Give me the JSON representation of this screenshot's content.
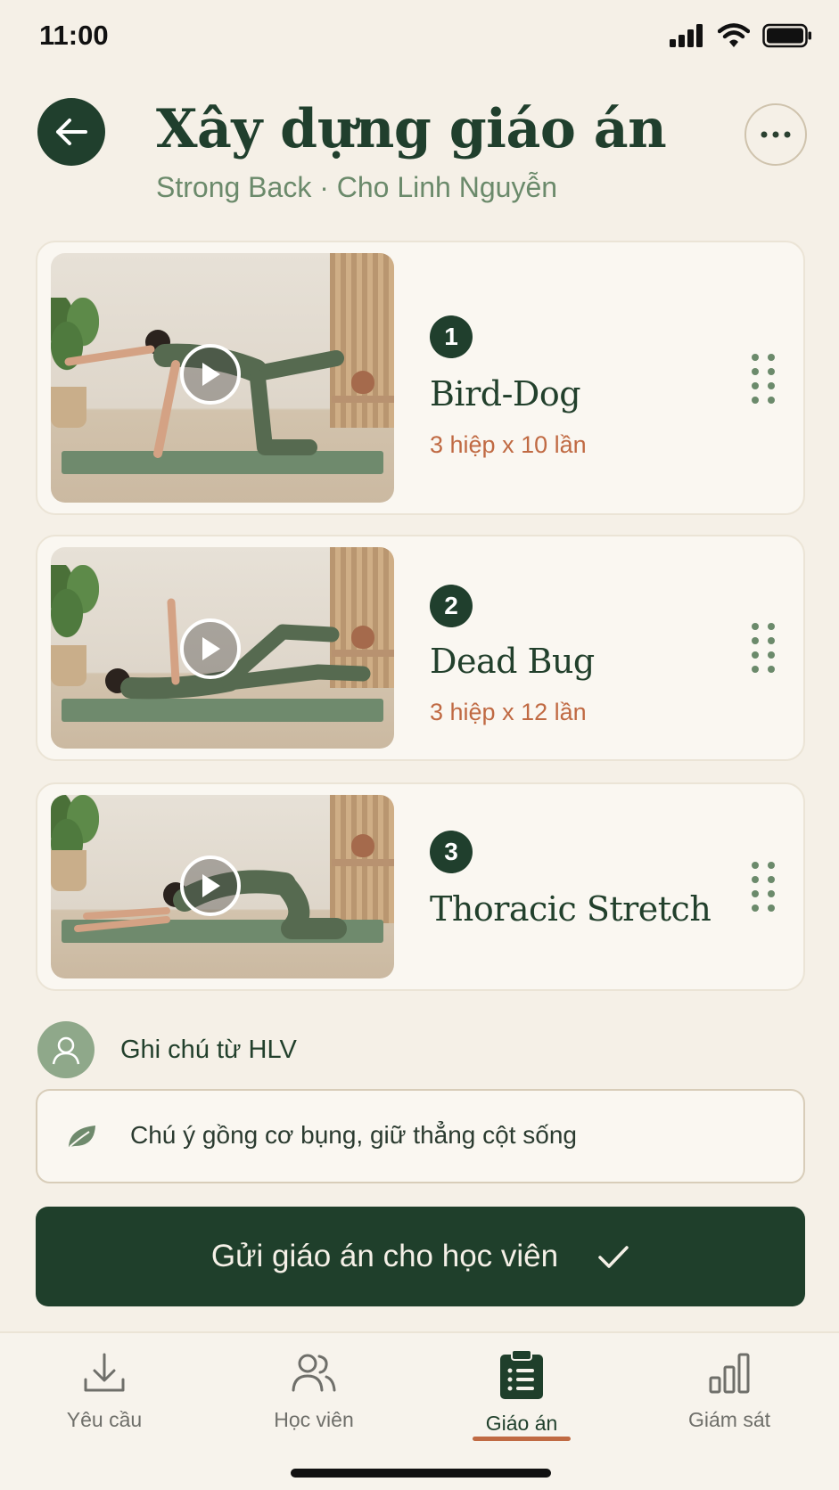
{
  "status_bar": {
    "time": "11:00"
  },
  "header": {
    "title": "Xây dựng giáo án",
    "subtitle": "Strong Back · Cho Linh Nguyễn"
  },
  "exercises": [
    {
      "number": "1",
      "name": "Bird-Dog",
      "sets": "3 hiệp x 10 lần"
    },
    {
      "number": "2",
      "name": "Dead Bug",
      "sets": "3 hiệp x 12 lần"
    },
    {
      "number": "3",
      "name": "Thoracic Stretch",
      "sets": ""
    }
  ],
  "coach_note": {
    "label": "Ghi chú từ HLV",
    "text": "Chú ý gồng cơ bụng, giữ thẳng cột sống"
  },
  "primary_action": {
    "label": "Gửi giáo án cho học viên"
  },
  "bottom_nav": {
    "items": [
      {
        "label": "Yêu cầu",
        "icon": "download-icon"
      },
      {
        "label": "Học viên",
        "icon": "users-icon"
      },
      {
        "label": "Giáo án",
        "icon": "clipboard-icon",
        "active": true
      },
      {
        "label": "Giám sát",
        "icon": "bar-chart-icon"
      }
    ]
  },
  "colors": {
    "background": "#f5f0e7",
    "primary": "#1f3f2b",
    "accent": "#c06a43",
    "muted_green": "#6b8a6b"
  }
}
